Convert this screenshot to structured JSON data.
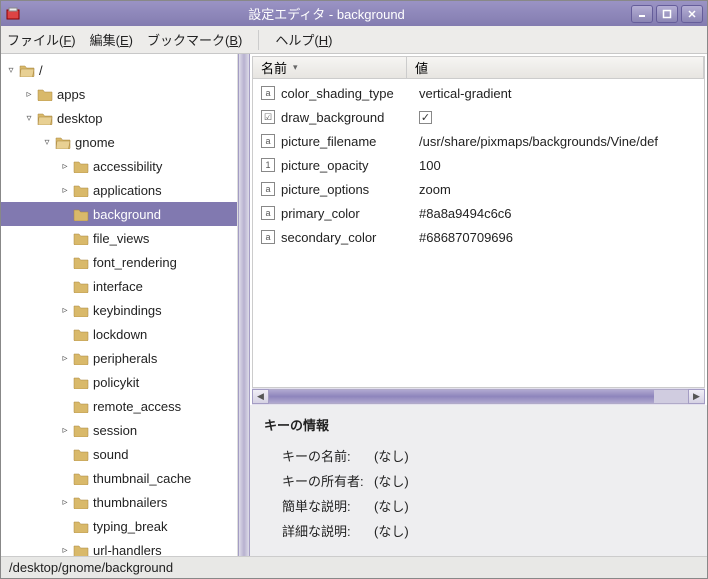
{
  "window": {
    "title": "設定エディタ - background"
  },
  "menu": {
    "file": "ファイル(",
    "file_u": "F",
    "edit": "編集(",
    "edit_u": "E",
    "bookmarks": "ブックマーク(",
    "bookmarks_u": "B",
    "help": "ヘルプ(",
    "help_u": "H",
    "close": ")"
  },
  "tree": {
    "root": "/",
    "items": [
      {
        "depth": 1,
        "label": "apps",
        "exp": "▹",
        "open": false
      },
      {
        "depth": 1,
        "label": "desktop",
        "exp": "▿",
        "open": true
      },
      {
        "depth": 2,
        "label": "gnome",
        "exp": "▿",
        "open": true
      },
      {
        "depth": 3,
        "label": "accessibility",
        "exp": "▹",
        "open": false
      },
      {
        "depth": 3,
        "label": "applications",
        "exp": "▹",
        "open": false
      },
      {
        "depth": 3,
        "label": "background",
        "exp": "",
        "open": false,
        "selected": true
      },
      {
        "depth": 3,
        "label": "file_views",
        "exp": "",
        "open": false
      },
      {
        "depth": 3,
        "label": "font_rendering",
        "exp": "",
        "open": false
      },
      {
        "depth": 3,
        "label": "interface",
        "exp": "",
        "open": false
      },
      {
        "depth": 3,
        "label": "keybindings",
        "exp": "▹",
        "open": false
      },
      {
        "depth": 3,
        "label": "lockdown",
        "exp": "",
        "open": false
      },
      {
        "depth": 3,
        "label": "peripherals",
        "exp": "▹",
        "open": false
      },
      {
        "depth": 3,
        "label": "policykit",
        "exp": "",
        "open": false
      },
      {
        "depth": 3,
        "label": "remote_access",
        "exp": "",
        "open": false
      },
      {
        "depth": 3,
        "label": "session",
        "exp": "▹",
        "open": false
      },
      {
        "depth": 3,
        "label": "sound",
        "exp": "",
        "open": false
      },
      {
        "depth": 3,
        "label": "thumbnail_cache",
        "exp": "",
        "open": false
      },
      {
        "depth": 3,
        "label": "thumbnailers",
        "exp": "▹",
        "open": false
      },
      {
        "depth": 3,
        "label": "typing_break",
        "exp": "",
        "open": false
      },
      {
        "depth": 3,
        "label": "url-handlers",
        "exp": "▹",
        "open": false
      }
    ]
  },
  "table": {
    "col_name": "名前",
    "col_value": "値",
    "rows": [
      {
        "type": "a",
        "name": "color_shading_type",
        "value": "vertical-gradient"
      },
      {
        "type": "chk",
        "name": "draw_background",
        "value": "✓"
      },
      {
        "type": "a",
        "name": "picture_filename",
        "value": "/usr/share/pixmaps/backgrounds/Vine/def"
      },
      {
        "type": "1",
        "name": "picture_opacity",
        "value": "100"
      },
      {
        "type": "a",
        "name": "picture_options",
        "value": "zoom"
      },
      {
        "type": "a",
        "name": "primary_color",
        "value": "#8a8a9494c6c6"
      },
      {
        "type": "a",
        "name": "secondary_color",
        "value": "#686870709696"
      }
    ]
  },
  "info": {
    "title": "キーの情報",
    "rows": [
      {
        "label": "キーの名前:",
        "value": "(なし)"
      },
      {
        "label": "キーの所有者:",
        "value": "(なし)"
      },
      {
        "label": "簡単な説明:",
        "value": "(なし)"
      },
      {
        "label": "詳細な説明:",
        "value": "(なし)"
      }
    ]
  },
  "statusbar": "/desktop/gnome/background"
}
